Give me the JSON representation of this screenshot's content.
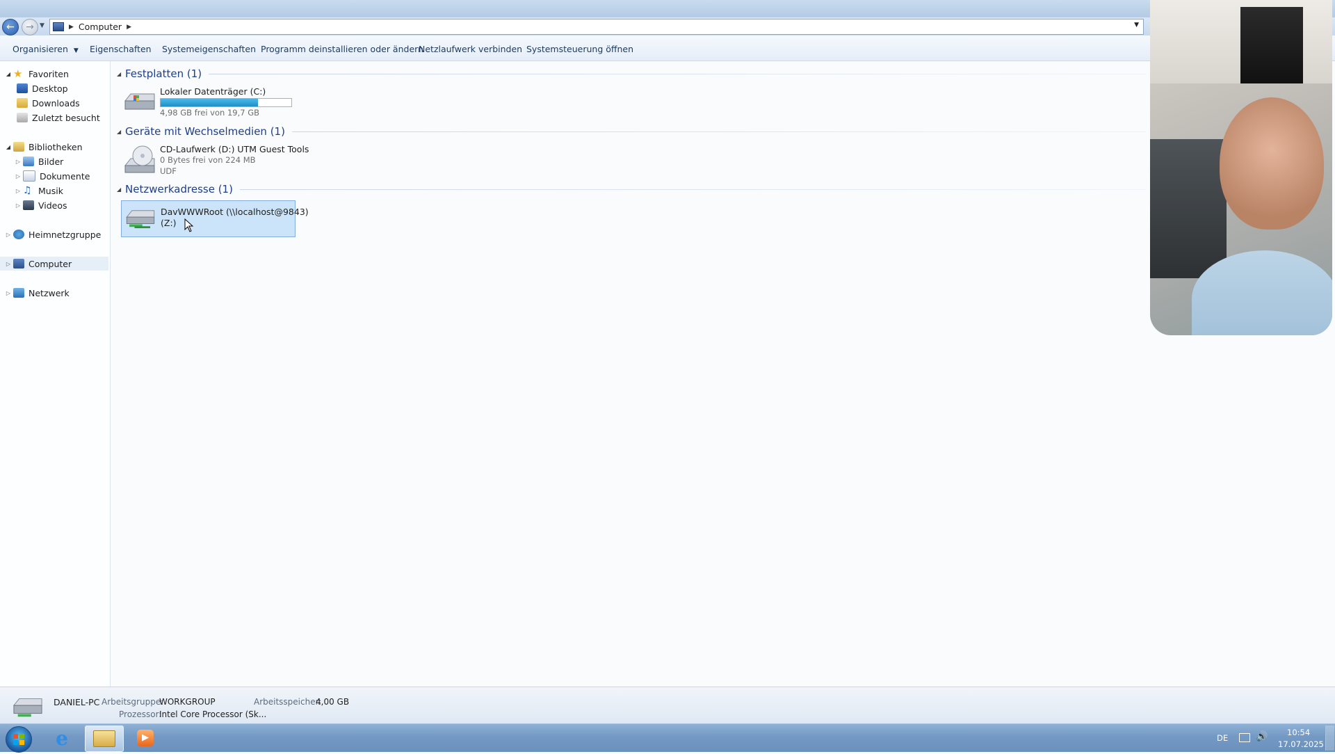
{
  "address_bar": {
    "crumbs": [
      "Computer"
    ]
  },
  "command_bar": {
    "organize": "Organisieren",
    "organize_arrow": "▼",
    "properties": "Eigenschaften",
    "system_properties": "Systemeigenschaften",
    "uninstall": "Programm deinstallieren oder ändern",
    "map_drive": "Netzlaufwerk verbinden",
    "control_panel": "Systemsteuerung öffnen"
  },
  "nav_pane": {
    "favorites": {
      "label": "Favoriten",
      "items": [
        "Desktop",
        "Downloads",
        "Zuletzt besucht"
      ]
    },
    "libraries": {
      "label": "Bibliotheken",
      "items": [
        "Bilder",
        "Dokumente",
        "Musik",
        "Videos"
      ]
    },
    "homegroup": "Heimnetzgruppe",
    "computer": "Computer",
    "network": "Netzwerk"
  },
  "groups": {
    "hard_disks": {
      "title": "Festplatten (1)",
      "drive": {
        "name": "Lokaler Datenträger (C:)",
        "free_text": "4,98 GB frei von 19,7 GB",
        "used_fraction": 0.747
      }
    },
    "removable": {
      "title": "Geräte mit Wechselmedien (1)",
      "drive": {
        "name": "CD-Laufwerk (D:) UTM Guest Tools",
        "free_text": "0 Bytes frei von 224 MB",
        "fs": "UDF"
      }
    },
    "network": {
      "title": "Netzwerkadresse (1)",
      "drive": {
        "name_line1": "DavWWWRoot (\\\\localhost@9843)",
        "name_line2": "(Z:)"
      }
    }
  },
  "details": {
    "pc_name": "DANIEL-PC",
    "workgroup_label": "Arbeitsgruppe:",
    "workgroup_value": "WORKGROUP",
    "memory_label": "Arbeitsspeicher:",
    "memory_value": "4,00 GB",
    "cpu_label": "Prozessor:",
    "cpu_value": "Intel Core Processor (Sk..."
  },
  "taskbar": {
    "language": "DE",
    "time": "10:54",
    "date": "17.07.2025"
  },
  "colors": {
    "accent": "#1e3e8c",
    "capacity": "#1d8ec5",
    "selection": "#cce4f9"
  }
}
